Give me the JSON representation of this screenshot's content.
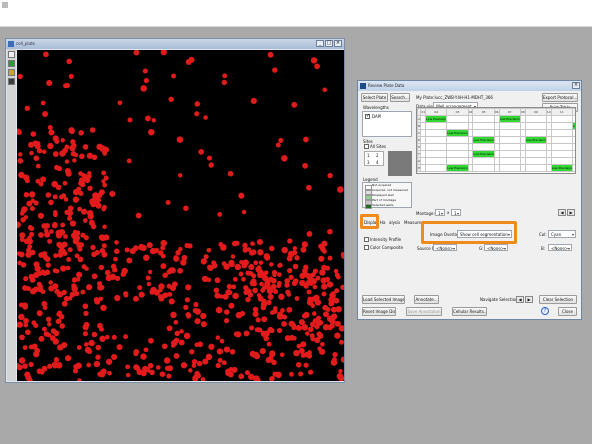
{
  "colors": {
    "accent_highlight": "#ef8a1c",
    "well_acquired": "#33d633",
    "cell_marker": "#e11b1b"
  },
  "image_window": {
    "title": "cell_plate",
    "tool_icons": [
      "zoom-icon",
      "pan-icon",
      "color-icon",
      "measure-icon"
    ]
  },
  "dialog": {
    "title": "Review Plate Data",
    "plate_path": "My Plate:lucc_ZWB-Y4H-H1-MDHT_366",
    "select_plate_label": "Select Plate",
    "search_label": "Search...",
    "export_protocol_label": "Export Protocol...",
    "print_table_label": "Print Table",
    "wavelengths_label": "Wavelengths",
    "wavelength_items": [
      {
        "name": "DAPI",
        "checked": true
      }
    ],
    "sites_label": "Sites",
    "all_sites_label": "All Sites",
    "sites_numbers": [
      "1",
      "2",
      "3",
      "4"
    ],
    "legend_label": "Legend",
    "legend_items": [
      "Not acquired",
      "Acquired, not measured",
      "Displayed well",
      "Part of montage",
      "Selected wells"
    ],
    "data_view_label": "Data view:",
    "data_view_value": "Well arrangement",
    "plate_columns": [
      "",
      "01",
      "02",
      "03",
      "04",
      "05",
      "06",
      "07",
      "08",
      "09",
      "10",
      "11",
      "12"
    ],
    "plate_rows": [
      [
        "A",
        "",
        "Low Precision",
        "",
        "",
        "",
        "",
        "Low Precision",
        "",
        "",
        "",
        "",
        ""
      ],
      [
        "B",
        "",
        "",
        "",
        "",
        "",
        "",
        "",
        "",
        "",
        "",
        "",
        "Low Precision"
      ],
      [
        "C",
        "",
        "",
        "Low Precision",
        "",
        "",
        "",
        "",
        "",
        "",
        "",
        "",
        ""
      ],
      [
        "D",
        "",
        "",
        "",
        "",
        "Low Precision",
        "",
        "",
        "",
        "Low Precision",
        "",
        "",
        ""
      ],
      [
        "E",
        "",
        "",
        "",
        "",
        "",
        "",
        "",
        "",
        "",
        "",
        "",
        ""
      ],
      [
        "F",
        "",
        "",
        "",
        "",
        "Low Precision",
        "",
        "",
        "",
        "",
        "",
        "",
        ""
      ],
      [
        "G",
        "",
        "",
        "",
        "",
        "",
        "",
        "",
        "",
        "",
        "",
        "",
        ""
      ],
      [
        "H",
        "",
        "",
        "Low Precision",
        "",
        "",
        "",
        "",
        "",
        "",
        "",
        "Low Precision",
        ""
      ]
    ],
    "montage_label": "Montage:",
    "montage_x": "1",
    "montage_y": "1",
    "tabs": [
      "Display",
      "Ha",
      "alysis",
      "Measurem"
    ],
    "intensity_profile_label": "Intensity Profile",
    "color_composite_label": "Color Composite",
    "image_overlay_label": "Image Overlay:",
    "image_overlay_value": "Show cell segmentation",
    "col_label": "Col:",
    "col_value": "Cyan",
    "source_r_label": "Source R:",
    "source_r_value": "<None>",
    "g_label": "G:",
    "g_value": "<None>",
    "b_label": "B:",
    "b_value": "<None>",
    "load_selected_images_label": "Load Selected Images",
    "annotate_label": "Annotate...",
    "navigate_selections_label": "Navigate Selections",
    "clear_selection_label": "Clear Selection",
    "reset_image_displays_label": "Reset Image Displays",
    "save_annotation_label": "Save Annotation",
    "cellular_results_label": "Cellular Results...",
    "close_label": "Close",
    "help_symbol": "?"
  }
}
